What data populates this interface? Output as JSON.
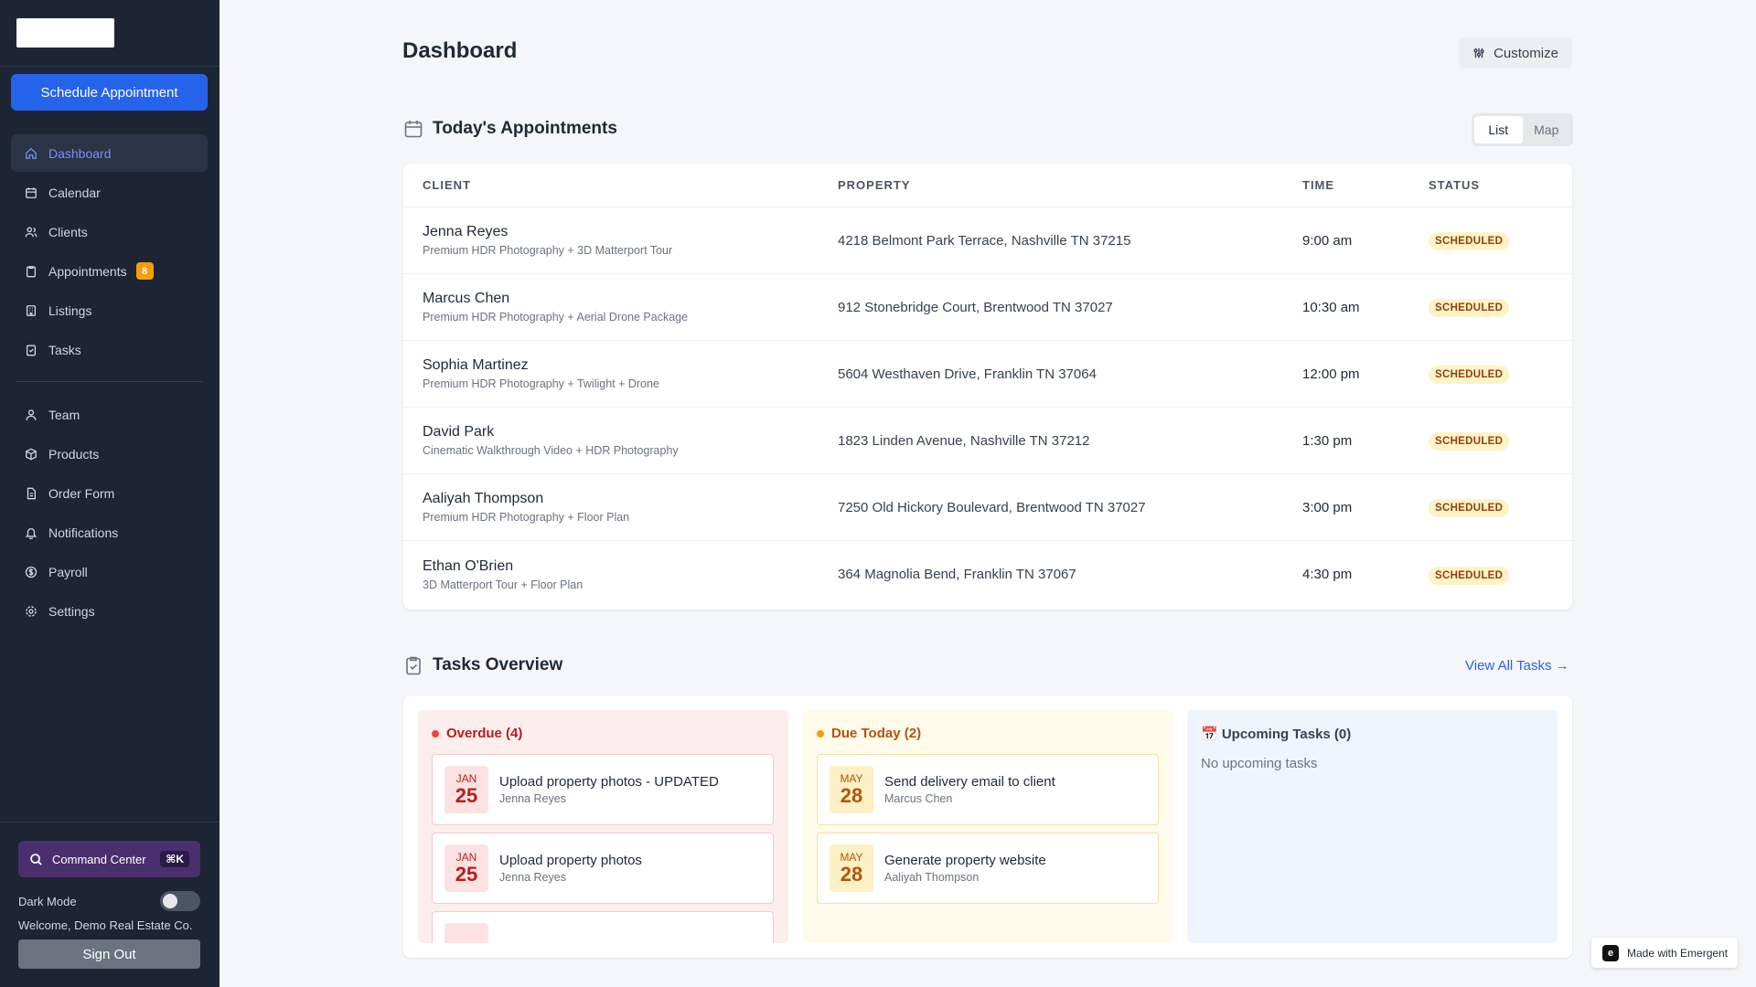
{
  "sidebar": {
    "schedule_label": "Schedule Appointment",
    "items": [
      {
        "label": "Dashboard",
        "icon": "home-icon",
        "active": true
      },
      {
        "label": "Calendar",
        "icon": "calendar-icon"
      },
      {
        "label": "Clients",
        "icon": "users-icon"
      },
      {
        "label": "Appointments",
        "icon": "clipboard-icon",
        "badge": "8"
      },
      {
        "label": "Listings",
        "icon": "building-icon"
      },
      {
        "label": "Tasks",
        "icon": "clipboard-check-icon"
      },
      {
        "label": "Team",
        "icon": "user-group-icon"
      },
      {
        "label": "Products",
        "icon": "package-icon"
      },
      {
        "label": "Order Form",
        "icon": "document-icon"
      },
      {
        "label": "Notifications",
        "icon": "bell-icon"
      },
      {
        "label": "Payroll",
        "icon": "dollar-icon"
      },
      {
        "label": "Settings",
        "icon": "gear-icon"
      }
    ],
    "command_center": {
      "label": "Command Center",
      "shortcut": "⌘K"
    },
    "dark_mode_label": "Dark Mode",
    "welcome": "Welcome, Demo Real Estate Co.",
    "sign_out": "Sign Out"
  },
  "header": {
    "title": "Dashboard",
    "customize_label": "Customize"
  },
  "appointments": {
    "title": "Today's Appointments",
    "view_toggle": {
      "list": "List",
      "map": "Map"
    },
    "columns": [
      "CLIENT",
      "PROPERTY",
      "TIME",
      "STATUS"
    ],
    "rows": [
      {
        "client": "Jenna Reyes",
        "service": "Premium HDR Photography + 3D Matterport Tour",
        "property": "4218 Belmont Park Terrace, Nashville TN 37215",
        "time": "9:00 am",
        "status": "SCHEDULED"
      },
      {
        "client": "Marcus Chen",
        "service": "Premium HDR Photography + Aerial Drone Package",
        "property": "912 Stonebridge Court, Brentwood TN 37027",
        "time": "10:30 am",
        "status": "SCHEDULED"
      },
      {
        "client": "Sophia Martinez",
        "service": "Premium HDR Photography + Twilight + Drone",
        "property": "5604 Westhaven Drive, Franklin TN 37064",
        "time": "12:00 pm",
        "status": "SCHEDULED"
      },
      {
        "client": "David Park",
        "service": "Cinematic Walkthrough Video + HDR Photography",
        "property": "1823 Linden Avenue, Nashville TN 37212",
        "time": "1:30 pm",
        "status": "SCHEDULED"
      },
      {
        "client": "Aaliyah Thompson",
        "service": "Premium HDR Photography + Floor Plan",
        "property": "7250 Old Hickory Boulevard, Brentwood TN 37027",
        "time": "3:00 pm",
        "status": "SCHEDULED"
      },
      {
        "client": "Ethan O'Brien",
        "service": "3D Matterport Tour + Floor Plan",
        "property": "364 Magnolia Bend, Franklin TN 37067",
        "time": "4:30 pm",
        "status": "SCHEDULED"
      }
    ]
  },
  "tasks": {
    "title": "Tasks Overview",
    "view_all": "View All Tasks →",
    "overdue": {
      "title": "Overdue (4)",
      "items": [
        {
          "month": "JAN",
          "day": "25",
          "title": "Upload property photos - UPDATED",
          "client": "Jenna Reyes"
        },
        {
          "month": "JAN",
          "day": "25",
          "title": "Upload property photos",
          "client": "Jenna Reyes"
        }
      ]
    },
    "due_today": {
      "title": "Due Today (2)",
      "items": [
        {
          "month": "MAY",
          "day": "28",
          "title": "Send delivery email to client",
          "client": "Marcus Chen"
        },
        {
          "month": "MAY",
          "day": "28",
          "title": "Generate property website",
          "client": "Aaliyah Thompson"
        }
      ]
    },
    "upcoming": {
      "title": "📅 Upcoming Tasks (0)",
      "empty": "No upcoming tasks"
    }
  },
  "footer_badge": {
    "label": "Made with Emergent"
  },
  "colors": {
    "sidebar_bg": "#1d2434",
    "primary": "#2563eb",
    "active_nav": "#7c8cf8",
    "badge_warning": "#f59e0b"
  }
}
